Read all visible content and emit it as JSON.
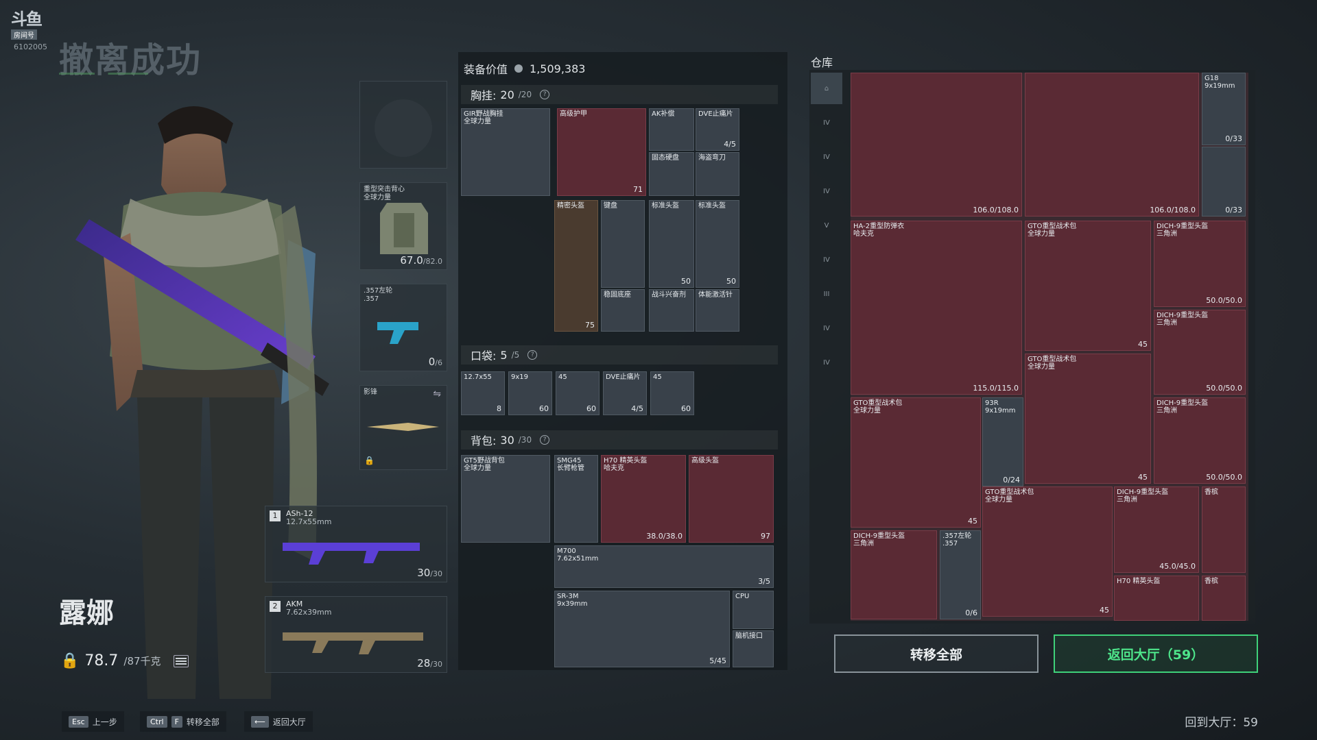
{
  "brand": {
    "logo_text": "斗鱼",
    "logo_tag": "房间号",
    "room_id": "6102005"
  },
  "status_title": "撤离成功",
  "character": {
    "name": "露娜",
    "weight": "78.7",
    "weight_max": "/87千克"
  },
  "hints": [
    {
      "keys": [
        "Esc"
      ],
      "label": "上一步"
    },
    {
      "keys": [
        "Ctrl",
        "F"
      ],
      "label": "转移全部"
    },
    {
      "keys": [
        "⟵"
      ],
      "label": "返回大厅"
    }
  ],
  "loadout": {
    "armor": {
      "label": "重型突击背心\n全球力量",
      "count": "67.0",
      "max": "/82.0"
    },
    "pistol": {
      "label": ".357左轮\n.357",
      "count": "0",
      "max": "/6"
    },
    "melee": {
      "label": "影锋"
    },
    "weapon1": {
      "index": "1",
      "name": "ASh-12",
      "caliber": "12.7x55mm",
      "count": "30",
      "max": "/30"
    },
    "weapon2": {
      "index": "2",
      "name": "AKM",
      "caliber": "7.62x39mm",
      "count": "28",
      "max": "/30"
    }
  },
  "equipment": {
    "value_label": "装备价值",
    "value": "1,509,383",
    "chest": {
      "label": "胸挂:",
      "count": "20",
      "max": "/20"
    },
    "pocket": {
      "label": "口袋:",
      "count": "5",
      "max": "/5"
    },
    "backpack": {
      "label": "背包:",
      "count": "30",
      "max": "/30"
    },
    "chest_items": [
      {
        "name": "GIR野战胸挂\n全球力量",
        "count": ""
      },
      {
        "name": "高级护甲",
        "count": "71"
      },
      {
        "name": "AK补偿",
        "count": ""
      },
      {
        "name": "DVE止痛片",
        "count": "4/5"
      },
      {
        "name": "固态硬盘",
        "count": ""
      },
      {
        "name": "海盗弯刀",
        "count": ""
      },
      {
        "name": "精密头盔",
        "count": "75"
      },
      {
        "name": "键盘",
        "count": ""
      },
      {
        "name": "标准头盔",
        "count": "50"
      },
      {
        "name": "标准头盔",
        "count": "50"
      },
      {
        "name": "稳固底座",
        "count": ""
      },
      {
        "name": "战斗兴奋剂",
        "count": ""
      },
      {
        "name": "体能激活针",
        "count": ""
      }
    ],
    "pocket_items": [
      {
        "name": "12.7x55",
        "count": "8"
      },
      {
        "name": "9x19",
        "count": "60"
      },
      {
        "name": "45",
        "count": "60"
      },
      {
        "name": "DVE止痛片",
        "count": "4/5"
      },
      {
        "name": "45",
        "count": "60"
      }
    ],
    "bag_items": [
      {
        "name": "GT5野战背包\n全球力量",
        "count": ""
      },
      {
        "name": "SMG45\n长臂枪管",
        "count": ""
      },
      {
        "name": "H70 精英头盔\n哈夫克",
        "count": "38.0/38.0"
      },
      {
        "name": "高级头盔",
        "count": "97"
      },
      {
        "name": "M700\n7.62x51mm",
        "count": "3/5"
      },
      {
        "name": "SR-3M\n9x39mm",
        "count": "5/45"
      },
      {
        "name": "CPU",
        "count": ""
      },
      {
        "name": "脑机接口",
        "count": ""
      }
    ]
  },
  "warehouse": {
    "label": "仓库",
    "nav": [
      "⌂",
      "IV",
      "IV",
      "IV",
      "V",
      "IV",
      "III",
      "IV",
      "IV"
    ],
    "items": [
      {
        "name": "",
        "count": "106.0/108.0"
      },
      {
        "name": "",
        "count": "106.0/108.0"
      },
      {
        "name": "G18\n9x19mm",
        "count": "0/33"
      },
      {
        "name": "",
        "count": "0/33"
      },
      {
        "name": "HA-2重型防弹衣\n哈夫克",
        "count": "115.0/115.0"
      },
      {
        "name": "GTO重型战术包\n全球力量",
        "count": "45"
      },
      {
        "name": "DICH-9重型头盔\n三角洲",
        "count": "50.0/50.0"
      },
      {
        "name": "DICH-9重型头盔\n三角洲",
        "count": "50.0/50.0"
      },
      {
        "name": "GTO重型战术包\n全球力量",
        "count": "45"
      },
      {
        "name": "GTO重型战术包\n全球力量",
        "count": "45"
      },
      {
        "name": "93R\n9x19mm",
        "count": "0/24"
      },
      {
        "name": "DICH-9重型头盔\n三角洲",
        "count": "50.0/50.0"
      },
      {
        "name": "GTO重型战术包\n全球力量",
        "count": "45"
      },
      {
        "name": "DICH-9重型头盔\n三角洲",
        "count": "45.0/45.0"
      },
      {
        "name": "香槟",
        "count": ""
      },
      {
        "name": "DICH-9重型头盔\n三角洲",
        "count": ""
      },
      {
        "name": ".357左轮\n.357",
        "count": "0/6"
      },
      {
        "name": "H70 精英头盔",
        "count": ""
      },
      {
        "name": "香槟",
        "count": ""
      }
    ]
  },
  "buttons": {
    "transfer_all": "转移全部",
    "return_hall": "返回大厅（59）"
  },
  "countdown": {
    "label": "回到大厅：",
    "value": "59"
  },
  "colors": {
    "accent": "#4ee58b",
    "item_red": "#5a2a34"
  }
}
